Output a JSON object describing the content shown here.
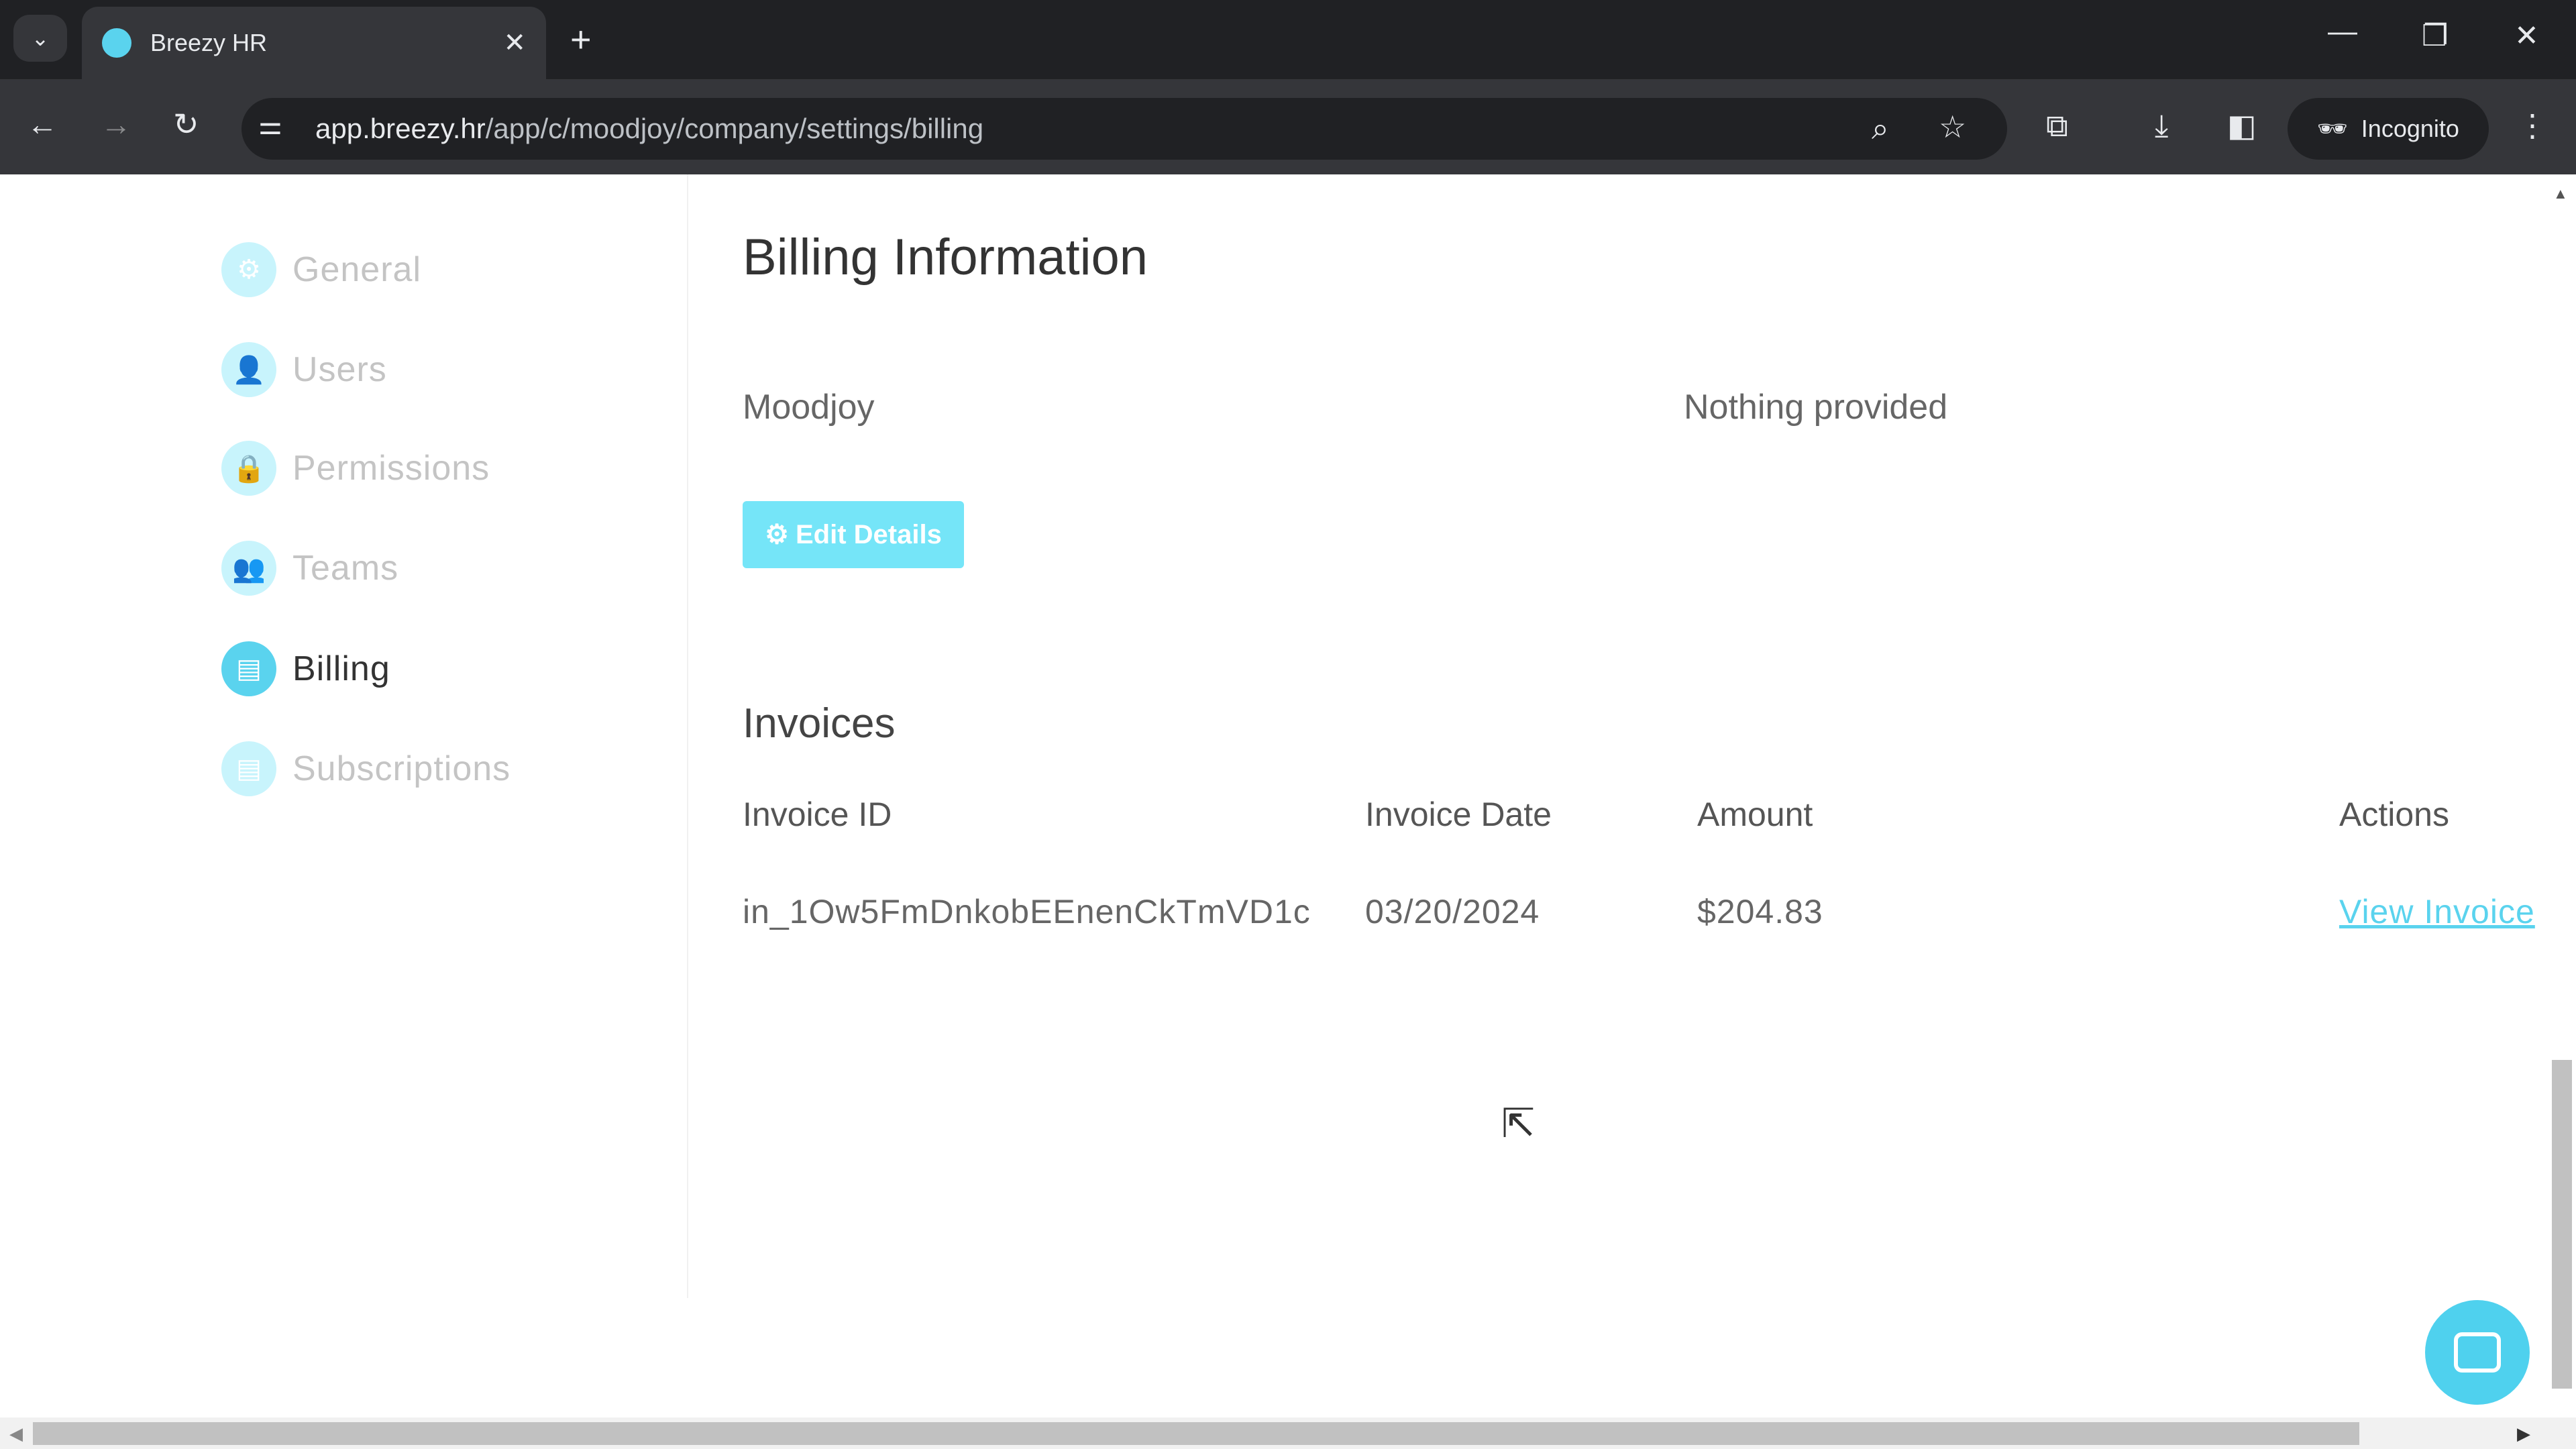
{
  "browser": {
    "tab_title": "Breezy HR",
    "url_host": "app.breezy.hr",
    "url_path": "/app/c/moodjoy/company/settings/billing",
    "incognito_label": "Incognito"
  },
  "sidebar": {
    "items": [
      {
        "label": "General",
        "icon": "gear-icon",
        "active": false
      },
      {
        "label": "Users",
        "icon": "user-icon",
        "active": false
      },
      {
        "label": "Permissions",
        "icon": "lock-icon",
        "active": false
      },
      {
        "label": "Teams",
        "icon": "team-icon",
        "active": false
      },
      {
        "label": "Billing",
        "icon": "credit-card-icon",
        "active": true
      },
      {
        "label": "Subscriptions",
        "icon": "list-icon",
        "active": false
      }
    ]
  },
  "billing": {
    "title": "Billing Information",
    "company": "Moodjoy",
    "address": "Nothing provided",
    "edit_label": "Edit Details"
  },
  "invoices": {
    "title": "Invoices",
    "headers": [
      "Invoice ID",
      "Invoice Date",
      "Amount",
      "Actions"
    ],
    "rows": [
      {
        "id": "in_1Ow5FmDnkobEEnenCkTmVD1c",
        "date": "03/20/2024",
        "amount": "$204.83",
        "action": "View Invoice"
      }
    ]
  },
  "colors": {
    "accent": "#5ad3ee",
    "button": "#75e5f8"
  }
}
